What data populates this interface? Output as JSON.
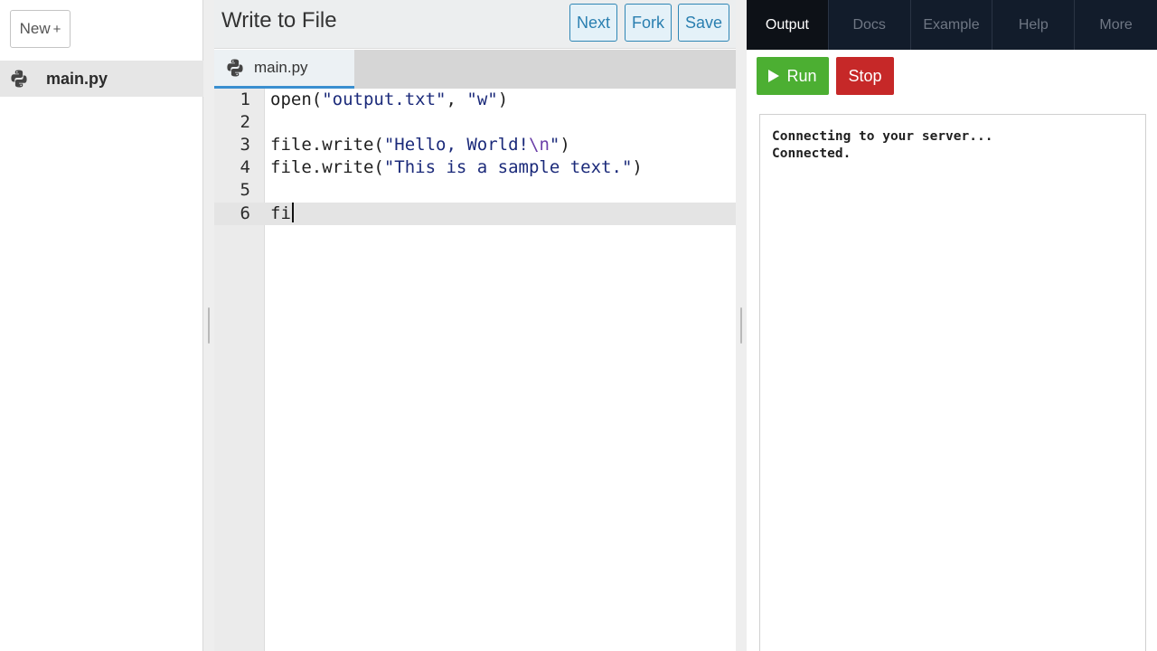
{
  "sidebar": {
    "new_label": "New",
    "new_icon": "plus-icon",
    "files": [
      {
        "name": "main.py",
        "icon": "python-icon"
      }
    ]
  },
  "editor": {
    "title": "Write to File",
    "buttons": {
      "next": "Next",
      "fork": "Fork",
      "save": "Save"
    },
    "active_tab": "main.py",
    "lines": [
      {
        "number": "1",
        "text": "open(\"output.txt\", \"w\")"
      },
      {
        "number": "2",
        "text": ""
      },
      {
        "number": "3",
        "text": "file.write(\"Hello, World!\\n\")"
      },
      {
        "number": "4",
        "text": "file.write(\"This is a sample text.\")"
      },
      {
        "number": "5",
        "text": ""
      },
      {
        "number": "6",
        "text": "fi"
      }
    ],
    "active_line": 6
  },
  "output": {
    "tabs": [
      "Output",
      "Docs",
      "Example",
      "Help",
      "More"
    ],
    "active_tab": "Output",
    "run_label": "Run",
    "stop_label": "Stop",
    "console_lines": [
      "Connecting to your server...",
      "Connected."
    ]
  },
  "colors": {
    "accent_blue": "#2f86b5",
    "run_green": "#4caf32",
    "stop_red": "#c62828",
    "output_tabbar": "#121c2b"
  }
}
